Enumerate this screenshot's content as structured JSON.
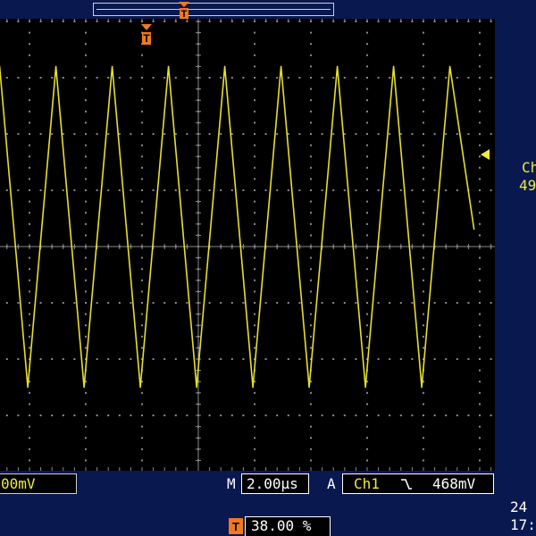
{
  "colors": {
    "background": "#0a1850",
    "screen": "#000000",
    "grid": "#8a8a8a",
    "trace": "#e6df2f",
    "marker": "#f0791c",
    "channel1": "#f0ec3a",
    "readout": "#ffffff"
  },
  "icons": {
    "trigger_position": "trigger-T-marker-icon",
    "trigger_level": "left-pointing-arrow-icon",
    "trigger_slope": "falling-edge-icon"
  },
  "status": {
    "ch1_scale": "00mV",
    "timebase_prefix": "M",
    "timebase": "2.00µs",
    "trigger_mode": "A",
    "trigger_source": "Ch1",
    "trigger_level": "468mV",
    "trigger_position_value": "38.00 %",
    "date_partial": "24",
    "time_partial": "17:"
  },
  "side_readout": {
    "line1": "Ch",
    "line2": "49"
  },
  "chart_data": {
    "type": "line",
    "title": "",
    "xlabel": "",
    "ylabel": "",
    "x_units": "divisions",
    "y_units": "divisions",
    "xlim": [
      0,
      8.9
    ],
    "ylim": [
      -4,
      4
    ],
    "grid": true,
    "series": [
      {
        "x": [
          0,
          0.47,
          0.97,
          1.47,
          1.97,
          2.47,
          2.97,
          3.47,
          3.97,
          4.47,
          4.97,
          5.47,
          5.97,
          6.47,
          6.97,
          7.47,
          7.97,
          8.47,
          8.9
        ],
        "y": [
          -2.5,
          3.2,
          -2.5,
          3.2,
          -2.5,
          3.2,
          -2.5,
          3.2,
          -2.5,
          3.2,
          -2.5,
          3.2,
          -2.5,
          3.2,
          -2.5,
          3.2,
          -2.5,
          3.2,
          0.3
        ]
      }
    ]
  }
}
